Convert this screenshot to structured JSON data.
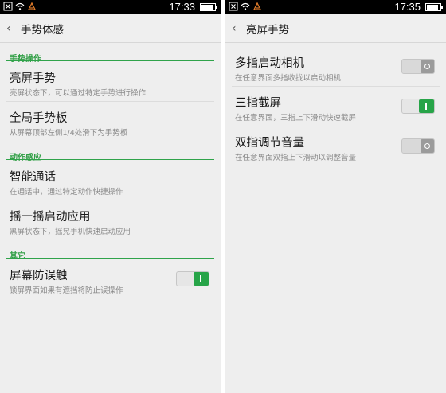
{
  "left": {
    "status_time": "17:33",
    "title": "手势体感",
    "sections": [
      {
        "header": "手势操作",
        "items": [
          {
            "label": "亮屏手势",
            "desc": "亮屏状态下，可以通过特定手势进行操作"
          },
          {
            "label": "全局手势板",
            "desc": "从屏幕顶部左侧1/4处滑下为手势板"
          }
        ]
      },
      {
        "header": "动作感应",
        "items": [
          {
            "label": "智能通话",
            "desc": "在通话中，通过特定动作快捷操作"
          },
          {
            "label": "摇一摇启动应用",
            "desc": "黑屏状态下，摇晃手机快速启动应用"
          }
        ]
      },
      {
        "header": "其它",
        "items": [
          {
            "label": "屏幕防误触",
            "desc": "锁屏界面如果有遮挡将防止误操作",
            "toggle": "on"
          }
        ]
      }
    ]
  },
  "right": {
    "status_time": "17:35",
    "title": "亮屏手势",
    "items": [
      {
        "label": "多指启动相机",
        "desc": "在任意界面多指收拢以启动相机",
        "toggle": "off"
      },
      {
        "label": "三指截屏",
        "desc": "在任意界面，三指上下滑动快速截屏",
        "toggle": "on"
      },
      {
        "label": "双指调节音量",
        "desc": "在任意界面双指上下滑动以调整音量",
        "toggle": "off"
      }
    ]
  },
  "icons": [
    "close-box-icon",
    "wifi-icon",
    "notification-icon",
    "battery-icon",
    "back-chevron-icon"
  ],
  "colors": {
    "accent": "#27a448",
    "background": "#eeeeee",
    "statusbar": "#000000"
  }
}
